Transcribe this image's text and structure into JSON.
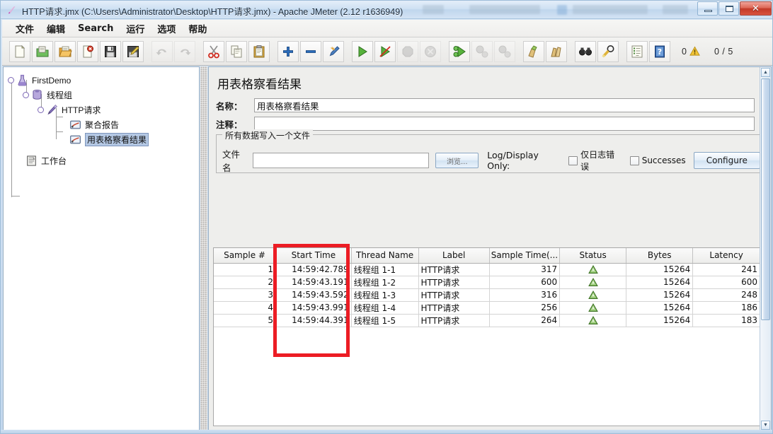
{
  "window": {
    "title": "HTTP请求.jmx (C:\\Users\\Administrator\\Desktop\\HTTP请求.jmx) - Apache JMeter (2.12 r1636949)",
    "minimize_label": "",
    "maximize_label": "",
    "close_label": "✕"
  },
  "menubar": {
    "items": [
      {
        "label": "文件",
        "name": "menu-file"
      },
      {
        "label": "编辑",
        "name": "menu-edit"
      },
      {
        "label": "Search",
        "name": "menu-search"
      },
      {
        "label": "运行",
        "name": "menu-run"
      },
      {
        "label": "选项",
        "name": "menu-options"
      },
      {
        "label": "帮助",
        "name": "menu-help"
      }
    ]
  },
  "toolbar": {
    "buttons": [
      {
        "icon": "new-document-icon",
        "enabled": true
      },
      {
        "icon": "templates-icon",
        "enabled": true
      },
      {
        "icon": "open-folder-icon",
        "enabled": true
      },
      {
        "icon": "close-document-icon",
        "enabled": true
      },
      {
        "icon": "save-icon",
        "enabled": true
      },
      {
        "icon": "save-as-icon",
        "enabled": true
      },
      {
        "icon": "undo-icon",
        "enabled": false
      },
      {
        "icon": "redo-icon",
        "enabled": false
      },
      {
        "icon": "cut-icon",
        "enabled": true
      },
      {
        "icon": "copy-icon",
        "enabled": true
      },
      {
        "icon": "paste-icon",
        "enabled": true
      },
      {
        "icon": "expand-all-icon",
        "enabled": true
      },
      {
        "icon": "collapse-all-icon",
        "enabled": true
      },
      {
        "icon": "toggle-icon",
        "enabled": true
      },
      {
        "icon": "start-icon",
        "enabled": true
      },
      {
        "icon": "start-no-pauses-icon",
        "enabled": true
      },
      {
        "icon": "stop-icon",
        "enabled": false
      },
      {
        "icon": "shutdown-icon",
        "enabled": false
      },
      {
        "icon": "remote-start-all-icon",
        "enabled": true
      },
      {
        "icon": "remote-stop-all-icon",
        "enabled": false
      },
      {
        "icon": "remote-shutdown-all-icon",
        "enabled": false
      },
      {
        "icon": "clear-icon",
        "enabled": true
      },
      {
        "icon": "clear-all-icon",
        "enabled": true
      },
      {
        "icon": "search-icon",
        "enabled": true
      },
      {
        "icon": "search-reset-icon",
        "enabled": true
      },
      {
        "icon": "function-helper-icon",
        "enabled": true
      },
      {
        "icon": "help-icon",
        "enabled": true
      }
    ],
    "warning_count": "0",
    "warning_icon": "warning-triangle-icon",
    "thread_counter": "0 / 5"
  },
  "tree": {
    "nodes": [
      {
        "label": "FirstDemo",
        "icon": "test-plan-flask-icon",
        "depth": 0,
        "selected": false
      },
      {
        "label": "线程组",
        "icon": "thread-group-spool-icon",
        "depth": 1,
        "selected": false
      },
      {
        "label": "HTTP请求",
        "icon": "http-request-pen-icon",
        "depth": 2,
        "selected": false
      },
      {
        "label": "聚合报告",
        "icon": "listener-meter-icon",
        "depth": 3,
        "selected": false
      },
      {
        "label": "用表格察看结果",
        "icon": "listener-meter-icon",
        "depth": 3,
        "selected": true
      },
      {
        "label": "工作台",
        "icon": "workbench-icon",
        "depth": 0,
        "selected": false
      }
    ]
  },
  "panel": {
    "title": "用表格察看结果",
    "name_label": "名称：",
    "name_value": "用表格察看结果",
    "comment_label": "注释：",
    "comment_value": "",
    "filegroup": {
      "title": "所有数据写入一个文件",
      "filename_label": "文件名",
      "filename_value": "",
      "browse_label": "浏览...",
      "logdisplay_label": "Log/Display Only:",
      "errors_only_label": "仅日志错误",
      "errors_only_checked": false,
      "successes_label": "Successes",
      "successes_checked": false,
      "configure_label": "Configure"
    }
  },
  "table": {
    "columns": [
      "Sample #",
      "Start Time",
      "Thread Name",
      "Label",
      "Sample Time(...",
      "Status",
      "Bytes",
      "Latency"
    ],
    "rows": [
      {
        "sample": "1",
        "start_time": "14:59:42.789",
        "thread_name": "线程组 1-1",
        "label": "HTTP请求",
        "sample_time": "317",
        "status": "success",
        "bytes": "15264",
        "latency": "241"
      },
      {
        "sample": "2",
        "start_time": "14:59:43.191",
        "thread_name": "线程组 1-2",
        "label": "HTTP请求",
        "sample_time": "600",
        "status": "success",
        "bytes": "15264",
        "latency": "600"
      },
      {
        "sample": "3",
        "start_time": "14:59:43.592",
        "thread_name": "线程组 1-3",
        "label": "HTTP请求",
        "sample_time": "316",
        "status": "success",
        "bytes": "15264",
        "latency": "248"
      },
      {
        "sample": "4",
        "start_time": "14:59:43.991",
        "thread_name": "线程组 1-4",
        "label": "HTTP请求",
        "sample_time": "256",
        "status": "success",
        "bytes": "15264",
        "latency": "186"
      },
      {
        "sample": "5",
        "start_time": "14:59:44.391",
        "thread_name": "线程组 1-5",
        "label": "HTTP请求",
        "sample_time": "264",
        "status": "success",
        "bytes": "15264",
        "latency": "183"
      }
    ]
  },
  "annotation": {
    "name": "red-highlight-box",
    "target_column": "Start Time",
    "color": "#ec1c24"
  },
  "colors": {
    "accent": "#b4c8e4",
    "annotation": "#ec1c24",
    "status_success": "#5a9e3a",
    "titlebar": "#cfe1f3"
  }
}
